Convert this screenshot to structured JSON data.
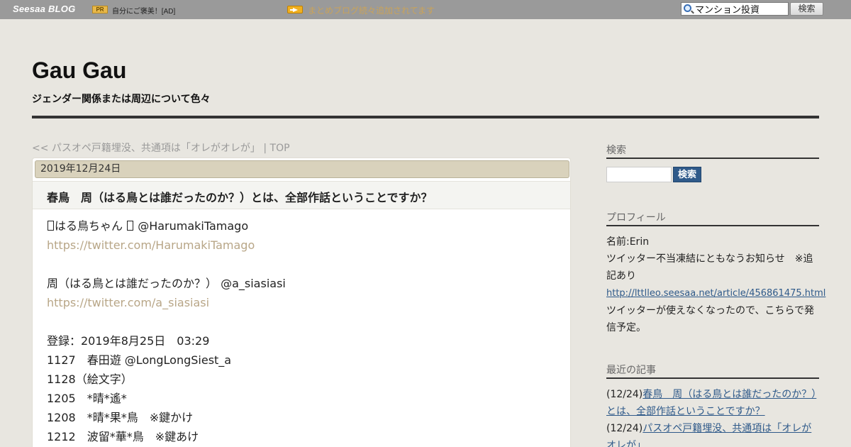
{
  "topbar": {
    "logo_main": "Seesaa",
    "logo_blog": "BLOG",
    "pr_badge": "PR",
    "pr_text": "自分にご褒美！[AD]",
    "notice_text": "まとめブログ続々追加されてます",
    "search_value": "マンション投資",
    "search_button": "検索"
  },
  "header": {
    "title": "Gau Gau",
    "description": "ジェンダー関係または周辺について色々"
  },
  "nav": {
    "prev_link": "<< パスオペ戸籍埋没、共通項は「オレがオレが」",
    "separator": "|",
    "top_link": "TOP"
  },
  "article": {
    "date": "2019年12月24日",
    "title": "春鳥　周（はる鳥とは誰だったのか？）とは、全部作話ということですか？",
    "lines": [
      {
        "pre": "",
        "text": "はる鳥ちゃん",
        "post": "@HarumakiTamago",
        "boxed": true
      },
      {
        "link": "https://twitter.com/HarumakiTamago"
      },
      {
        "text": ""
      },
      {
        "text": "周（はる鳥とは誰だったのか？） @a_siasiasi"
      },
      {
        "link": "https://twitter.com/a_siasiasi"
      },
      {
        "text": ""
      },
      {
        "text": "登録：2019年8月25日　03:29"
      },
      {
        "text": "1127　春田遊 @LongLongSiest_a"
      },
      {
        "text": "1128（絵文字）"
      },
      {
        "text": "1205　*晴*遙*"
      },
      {
        "text": "1208　*晴*果*鳥　※鍵かけ"
      },
      {
        "text": "1212　波留*華*鳥　※鍵あけ"
      }
    ]
  },
  "sidebar": {
    "search_heading": "検索",
    "search_button": "検索",
    "profile_heading": "プロフィール",
    "profile_name": "名前:Erin",
    "profile_note": "ツイッター不当凍結にともなうお知らせ　※追記あり",
    "profile_link": "http://lttlleo.seesaa.net/article/456861475.html",
    "profile_note2": "ツイッターが使えなくなったので、こちらで発信予定。",
    "recent_heading": "最近の記事",
    "recent": [
      {
        "date": "(12/24)",
        "title": "春鳥　周（はる鳥とは誰だったのか？）とは、全部作話ということですか？"
      },
      {
        "date": "(12/24)",
        "title": "パスオペ戸籍埋没、共通項は「オレがオレが」"
      }
    ]
  },
  "colors": {
    "page_bg": "#e8e6e0",
    "topbar_bg": "#9a9a9a",
    "date_bar_bg": "#d9d2bc",
    "link_tan": "#b8a687",
    "sidebar_link": "#2f5a8a",
    "search_button_bg": "#2f5a8a"
  }
}
